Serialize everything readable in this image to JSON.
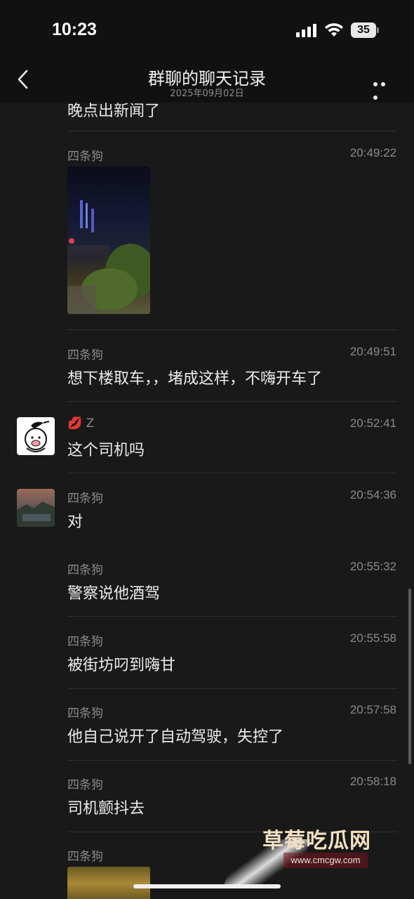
{
  "status_bar": {
    "time": "10:23",
    "battery": "35"
  },
  "nav": {
    "title": "群聊的聊天记录",
    "subtitle": "2025年09月02日"
  },
  "partial_message": "晚点出新闻了",
  "messages": [
    {
      "sender": "四条狗",
      "time": "20:49:22",
      "type": "image"
    },
    {
      "sender": "四条狗",
      "time": "20:49:51",
      "text": "想下楼取车，，堵成这样，不嗨开车了"
    },
    {
      "sender": "Z",
      "sender_emoji": "💋",
      "time": "20:52:41",
      "text": "这个司机吗"
    },
    {
      "sender": "四条狗",
      "time": "20:54:36",
      "text": "对"
    },
    {
      "sender": "四条狗",
      "time": "20:55:32",
      "text": "警察说他酒驾"
    },
    {
      "sender": "四条狗",
      "time": "20:55:58",
      "text": "被街坊叼到嗨甘"
    },
    {
      "sender": "四条狗",
      "time": "20:57:58",
      "text": "他自己说开了自动驾驶，失控了"
    },
    {
      "sender": "四条狗",
      "time": "20:58:18",
      "text": "司机颤抖去"
    },
    {
      "sender": "四条狗",
      "type": "image"
    }
  ],
  "watermark": {
    "title": "草莓吃瓜网",
    "url": "www.cmcgw.com"
  }
}
